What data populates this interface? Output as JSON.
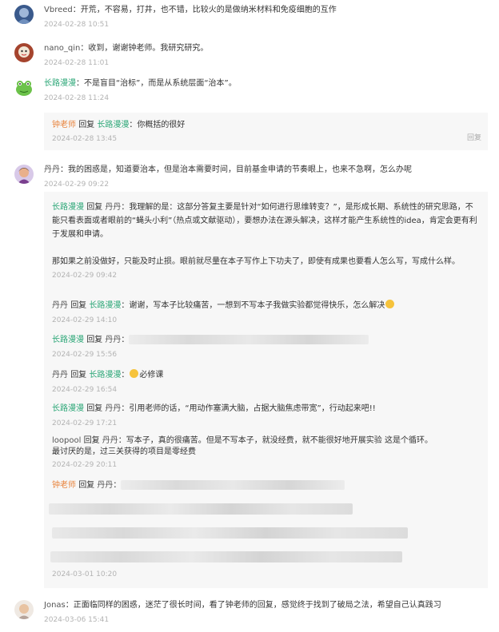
{
  "comments": [
    {
      "user": "Vbreed",
      "text": "：开荒，不容易，打井，也不错，比较火的是做纳米材料和免疫细胞的互作",
      "time": "2024-02-28 10:51"
    },
    {
      "user": "nano_qin",
      "text": "：收到，谢谢钟老师。我研究研究。",
      "time": "2024-02-28 11:01"
    },
    {
      "user": "长路漫漫",
      "text": "：不是盲目“治标”，而是从系统层面“治本”。",
      "time": "2024-02-28 11:24",
      "replies": [
        {
          "user": "钟老师",
          "verb": "回复",
          "target": "长路漫漫",
          "text": "：你概括的很好",
          "time": "2024-02-28 13:45",
          "reply_label": "回复"
        }
      ]
    },
    {
      "user": "丹丹",
      "text": "：我的困惑是，知道要治本，但是治本需要时间，目前基金申请的节奏眼上，也来不急啊，怎么办呢",
      "time": "2024-02-29 09:22",
      "replies": [
        {
          "user": "长路漫漫",
          "verb": "回复",
          "target": "丹丹",
          "text": "：我理解的是：这部分答复主要是针对“如何进行思维转变？”，是形成长期、系统性的研究思路，不能只看表面或者眼前的“蝇头小利”（热点或文献驱动），要想办法在源头解决，这样才能产生系统性的idea，肯定会更有利于发展和申请。",
          "text2": "那如果之前没做好，只能及时止损。眼前就尽量在本子写作上下功夫了，即使有成果也要看人怎么写，写成什么样。",
          "time": "2024-02-29 09:42"
        },
        {
          "user": "丹丹",
          "verb": "回复",
          "target": "长路漫漫",
          "text": "：谢谢，写本子比较痛苦，一想到不写本子我做实验都觉得快乐，怎么解决",
          "time": "2024-02-29 14:10"
        },
        {
          "user": "长路漫漫",
          "verb": "回复",
          "target": "丹丹",
          "text": "：",
          "time": "2024-02-29 15:56"
        },
        {
          "user": "丹丹",
          "verb": "回复",
          "target": "长路漫漫",
          "text": "必修课",
          "time": "2024-02-29 16:54"
        },
        {
          "user": "长路漫漫",
          "verb": "回复",
          "target": "丹丹",
          "text": "：引用老师的话，“用动作塞满大脑，占据大脑焦虑带宽”，行动起来吧!!",
          "time": "2024-02-29 17:21"
        },
        {
          "user": "loopool",
          "verb": "回复",
          "target": "丹丹",
          "text": "：写本子，真的很痛苦。但是不写本子，就没经费，就不能很好地开展实验 这是个循环。",
          "text2": "最讨厌的是，过三关获得的项目是零经费",
          "time": "2024-02-29 20:11"
        },
        {
          "user": "钟老师",
          "verb": "回复",
          "target": "丹丹",
          "text": "：",
          "time": "2024-03-01 10:20"
        }
      ]
    },
    {
      "user": "Jonas",
      "text": "：正面临同样的困惑，迷茫了很长时间，看了钟老师的回复，感觉终于找到了破局之法，希望自己认真践习",
      "time": "2024-03-06 15:41"
    }
  ],
  "colors": {
    "green": "#2aa676",
    "orange": "#e8843d",
    "timestamp": "#b3b3b3",
    "reply_bg": "#f7f7f7"
  }
}
